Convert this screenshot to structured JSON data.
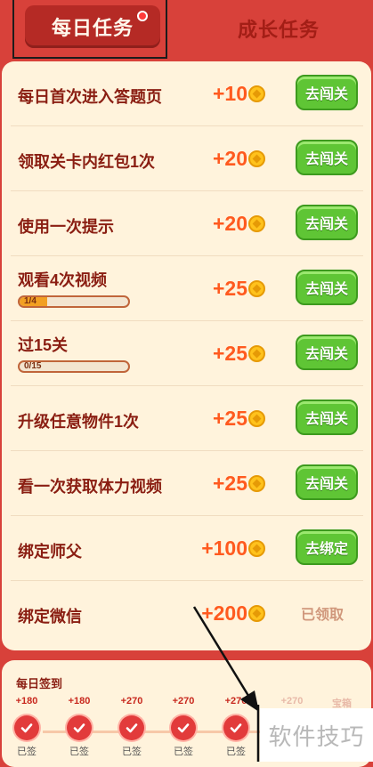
{
  "tabs": {
    "daily": "每日任务",
    "growth": "成长任务"
  },
  "tasks": [
    {
      "title": "每日首次进入答题页",
      "reward": "+10",
      "action": "去闯关"
    },
    {
      "title": "领取关卡内红包1次",
      "reward": "+20",
      "action": "去闯关"
    },
    {
      "title": "使用一次提示",
      "reward": "+20",
      "action": "去闯关"
    },
    {
      "title": "观看4次视频",
      "reward": "+25",
      "action": "去闯关",
      "progress_text": "1/4",
      "progress": 0.25
    },
    {
      "title": "过15关",
      "reward": "+25",
      "action": "去闯关",
      "progress_text": "0/15",
      "progress": 0
    },
    {
      "title": "升级任意物件1次",
      "reward": "+25",
      "action": "去闯关"
    },
    {
      "title": "看一次获取体力视频",
      "reward": "+25",
      "action": "去闯关"
    },
    {
      "title": "绑定师父",
      "reward": "+100",
      "action": "去绑定"
    },
    {
      "title": "绑定微信",
      "reward": "+200",
      "status": "已领取"
    }
  ],
  "signin": {
    "title": "每日签到",
    "days": [
      {
        "reward": "+180",
        "label": "已签"
      },
      {
        "reward": "+180",
        "label": "已签"
      },
      {
        "reward": "+270",
        "label": "已签"
      },
      {
        "reward": "+270",
        "label": "已签"
      },
      {
        "reward": "+270",
        "label": "已签"
      }
    ],
    "partial": [
      "+270",
      "宝箱"
    ]
  },
  "watermark": "软件技巧",
  "colors": {
    "background_red": "#d8413a",
    "panel": "#fff3dc",
    "title_text": "#8a1e12",
    "reward_orange": "#ff5a1f",
    "button_green": "#5fc535"
  }
}
